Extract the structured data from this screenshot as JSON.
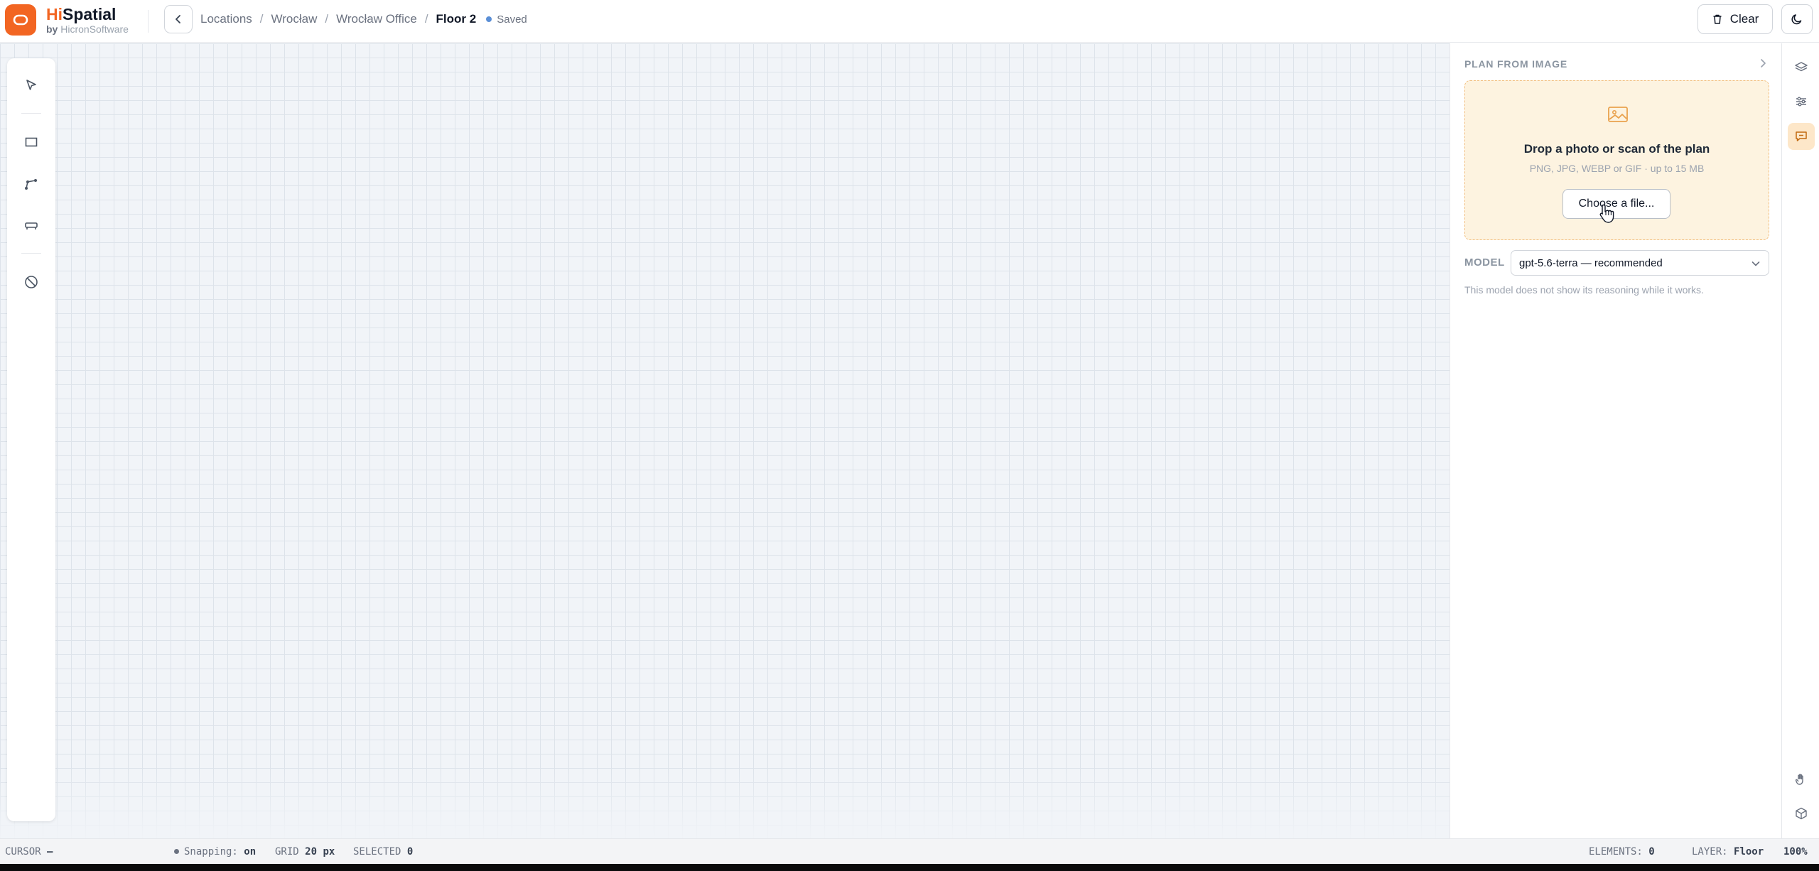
{
  "app": {
    "brand_hi": "Hi",
    "brand_rest": "Spatial",
    "brand_by": "by",
    "brand_maker": "HicronSoftware"
  },
  "breadcrumb": {
    "items": [
      "Locations",
      "Wrocław",
      "Wrocław Office",
      "Floor 2"
    ],
    "separator": "/",
    "status": "Saved"
  },
  "header": {
    "clear_label": "Clear"
  },
  "toolbar": {
    "tools": [
      "select-tool",
      "rectangle-tool",
      "polyline-tool",
      "furniture-tool",
      "forbidden-area-tool"
    ]
  },
  "panel": {
    "title": "PLAN FROM IMAGE",
    "dropzone": {
      "title": "Drop a photo or scan of the plan",
      "subtitle": "PNG, JPG, WEBP or GIF · up to 15 MB",
      "button_label": "Choose a file..."
    },
    "model_label": "MODEL",
    "model_value": "gpt-5.6-terra — recommended",
    "model_note": "This model does not show its reasoning while it works."
  },
  "rail": {
    "items": [
      "layers-icon",
      "sliders-icon",
      "ai-chat-icon",
      "hand-icon",
      "cube-icon"
    ],
    "active": "ai-chat-icon"
  },
  "statusbar": {
    "cursor_label": "CURSOR",
    "cursor_value": "—",
    "snapping_label": "Snapping:",
    "snapping_value": "on",
    "grid_label": "GRID",
    "grid_value": "20 px",
    "selected_label": "SELECTED",
    "selected_value": "0",
    "elements_label": "ELEMENTS:",
    "elements_value": "0",
    "layer_label": "LAYER:",
    "layer_value": "Floor",
    "zoom_value": "100%"
  },
  "colors": {
    "brand": "#f26522",
    "accent_soft": "#fde7c9",
    "dropzone_bg": "#fdf3e0",
    "saved_dot": "#5b8fd6"
  }
}
